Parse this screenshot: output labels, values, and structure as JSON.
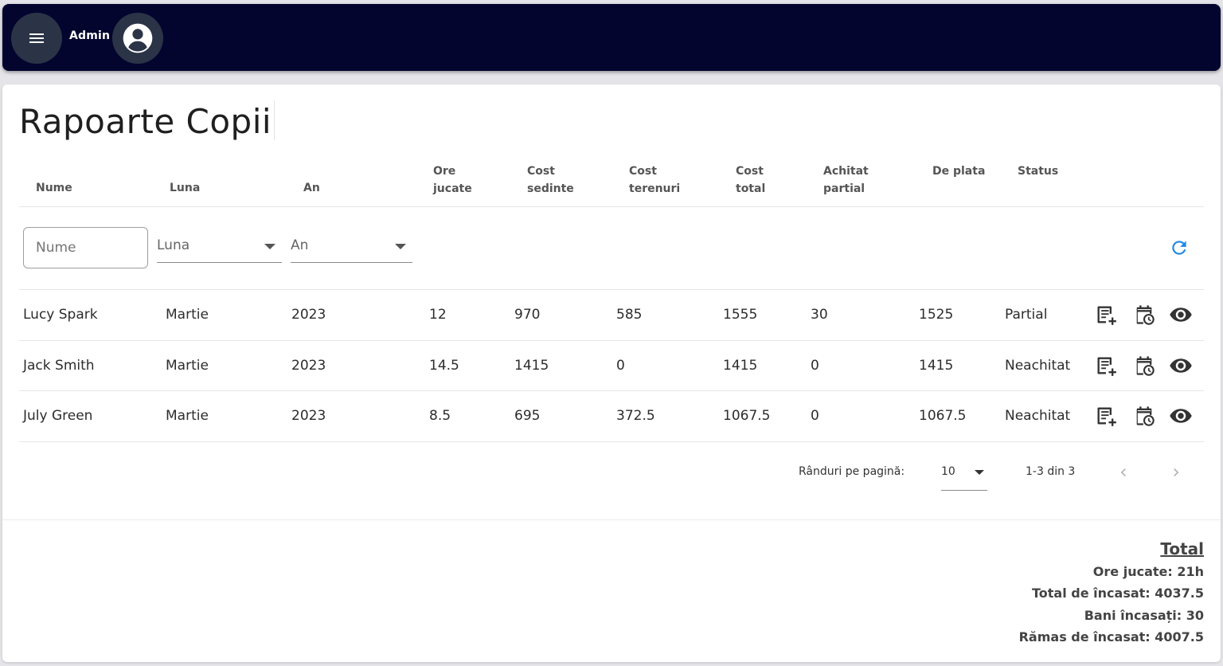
{
  "header": {
    "user_label": "Admin",
    "icons": {
      "menu": "menu-icon",
      "account": "account-circle-icon"
    },
    "background_color": "#03052e"
  },
  "page": {
    "title": "Rapoarte Copii"
  },
  "table": {
    "columns": [
      [
        "Nume",
        ""
      ],
      [
        "Luna",
        ""
      ],
      [
        "An",
        ""
      ],
      [
        "Ore",
        "jucate"
      ],
      [
        "Cost",
        "sedinte"
      ],
      [
        "Cost",
        "terenuri"
      ],
      [
        "Cost",
        "total"
      ],
      [
        "Achitat",
        "partial"
      ],
      [
        "De plata",
        ""
      ],
      [
        "Status",
        ""
      ]
    ],
    "filters": {
      "name_placeholder": "Nume",
      "month_placeholder": "Luna",
      "year_placeholder": "An",
      "refresh_icon": "refresh-icon"
    },
    "rows": [
      [
        "Lucy Spark",
        "Martie",
        "2023",
        "12",
        "970",
        "585",
        "1555",
        "30",
        "1525",
        "Partial"
      ],
      [
        "Jack Smith",
        "Martie",
        "2023",
        "14.5",
        "1415",
        "0",
        "1415",
        "0",
        "1415",
        "Neachitat"
      ],
      [
        "July Green",
        "Martie",
        "2023",
        "8.5",
        "695",
        "372.5",
        "1067.5",
        "0",
        "1067.5",
        "Neachitat"
      ]
    ],
    "row_actions": [
      "add-note-icon",
      "calendar-clock-icon",
      "eye-icon"
    ]
  },
  "pagination": {
    "rows_per_page_label": "Rânduri pe pagină:",
    "rows_per_page_value": "10",
    "range_text": "1-3 din 3",
    "prev_icon": "chevron-left-icon",
    "next_icon": "chevron-right-icon"
  },
  "totals": {
    "title": "Total",
    "lines": [
      "Ore jucate: 21h",
      "Total de încasat: 4037.5",
      "Bani încasați: 30",
      "Rămas de încasat: 4007.5"
    ]
  },
  "colors": {
    "accent": "#1e88e5",
    "icon": "#333333"
  }
}
